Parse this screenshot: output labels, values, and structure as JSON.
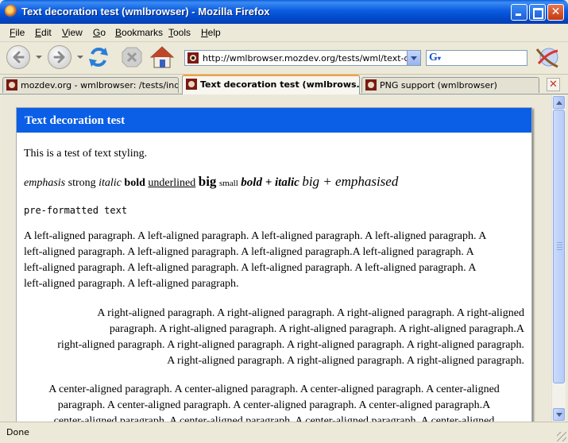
{
  "window": {
    "title": "Text decoration test (wmlbrowser) - Mozilla Firefox",
    "app_icon": "firefox-icon",
    "controls": [
      "minimize-icon",
      "maximize-icon",
      "close-icon"
    ]
  },
  "menubar": {
    "items": [
      {
        "label_prefix": "",
        "accel": "F",
        "label_suffix": "ile"
      },
      {
        "label_prefix": "",
        "accel": "E",
        "label_suffix": "dit"
      },
      {
        "label_prefix": "",
        "accel": "V",
        "label_suffix": "iew"
      },
      {
        "label_prefix": "",
        "accel": "G",
        "label_suffix": "o"
      },
      {
        "label_prefix": "",
        "accel": "B",
        "label_suffix": "ookmarks"
      },
      {
        "label_prefix": "",
        "accel": "T",
        "label_suffix": "ools"
      },
      {
        "label_prefix": "",
        "accel": "H",
        "label_suffix": "elp"
      }
    ]
  },
  "toolbar": {
    "icons": [
      "back-arrow-icon",
      "forward-arrow-icon",
      "reload-icon",
      "stop-icon",
      "home-icon"
    ],
    "url": "http://wmlbrowser.mozdev.org/tests/wml/text-decor",
    "search_engine_icon": "google-icon",
    "search_value": ""
  },
  "tabs": [
    {
      "label": "mozdev.org - wmlbrowser: /tests/index",
      "active": false
    },
    {
      "label": "Text decoration test (wmlbrows...",
      "active": true
    },
    {
      "label": "PNG support (wmlbrowser)",
      "active": false
    }
  ],
  "page": {
    "header": "Text decoration test",
    "intro": "This is a test of text styling.",
    "styles": {
      "emphasis": "emphasis",
      "strong": "strong",
      "italic": "italic",
      "bold": "bold",
      "underlined": "underlined",
      "big": "big",
      "small": "small",
      "bold_italic": "bold + italic",
      "big_emph": "big + emphasised"
    },
    "preformatted": "pre-formatted text",
    "left_lines": [
      "A left-aligned paragraph. A left-aligned paragraph. A left-aligned paragraph. A left-aligned paragraph. A",
      "left-aligned paragraph. A left-aligned paragraph. A left-aligned paragraph.A left-aligned paragraph. A",
      "left-aligned paragraph. A left-aligned paragraph. A left-aligned paragraph. A left-aligned paragraph. A",
      "left-aligned paragraph. A left-aligned paragraph."
    ],
    "right_lines": [
      "A right-aligned paragraph. A right-aligned paragraph. A right-aligned paragraph. A right-aligned",
      "paragraph. A right-aligned paragraph. A right-aligned paragraph. A right-aligned paragraph.A",
      "right-aligned paragraph. A right-aligned paragraph. A right-aligned paragraph. A right-aligned paragraph.",
      "A right-aligned paragraph. A right-aligned paragraph. A right-aligned paragraph."
    ],
    "center_lines": [
      "A center-aligned paragraph. A center-aligned paragraph. A center-aligned paragraph. A center-aligned",
      "paragraph. A center-aligned paragraph. A center-aligned paragraph. A center-aligned paragraph.A",
      "center-aligned paragraph. A center-aligned paragraph. A center-aligned paragraph. A center-aligned"
    ]
  },
  "status": {
    "text": "Done"
  },
  "colors": {
    "card_header": "#0b5ee6",
    "titlebar": "#0047c7"
  }
}
